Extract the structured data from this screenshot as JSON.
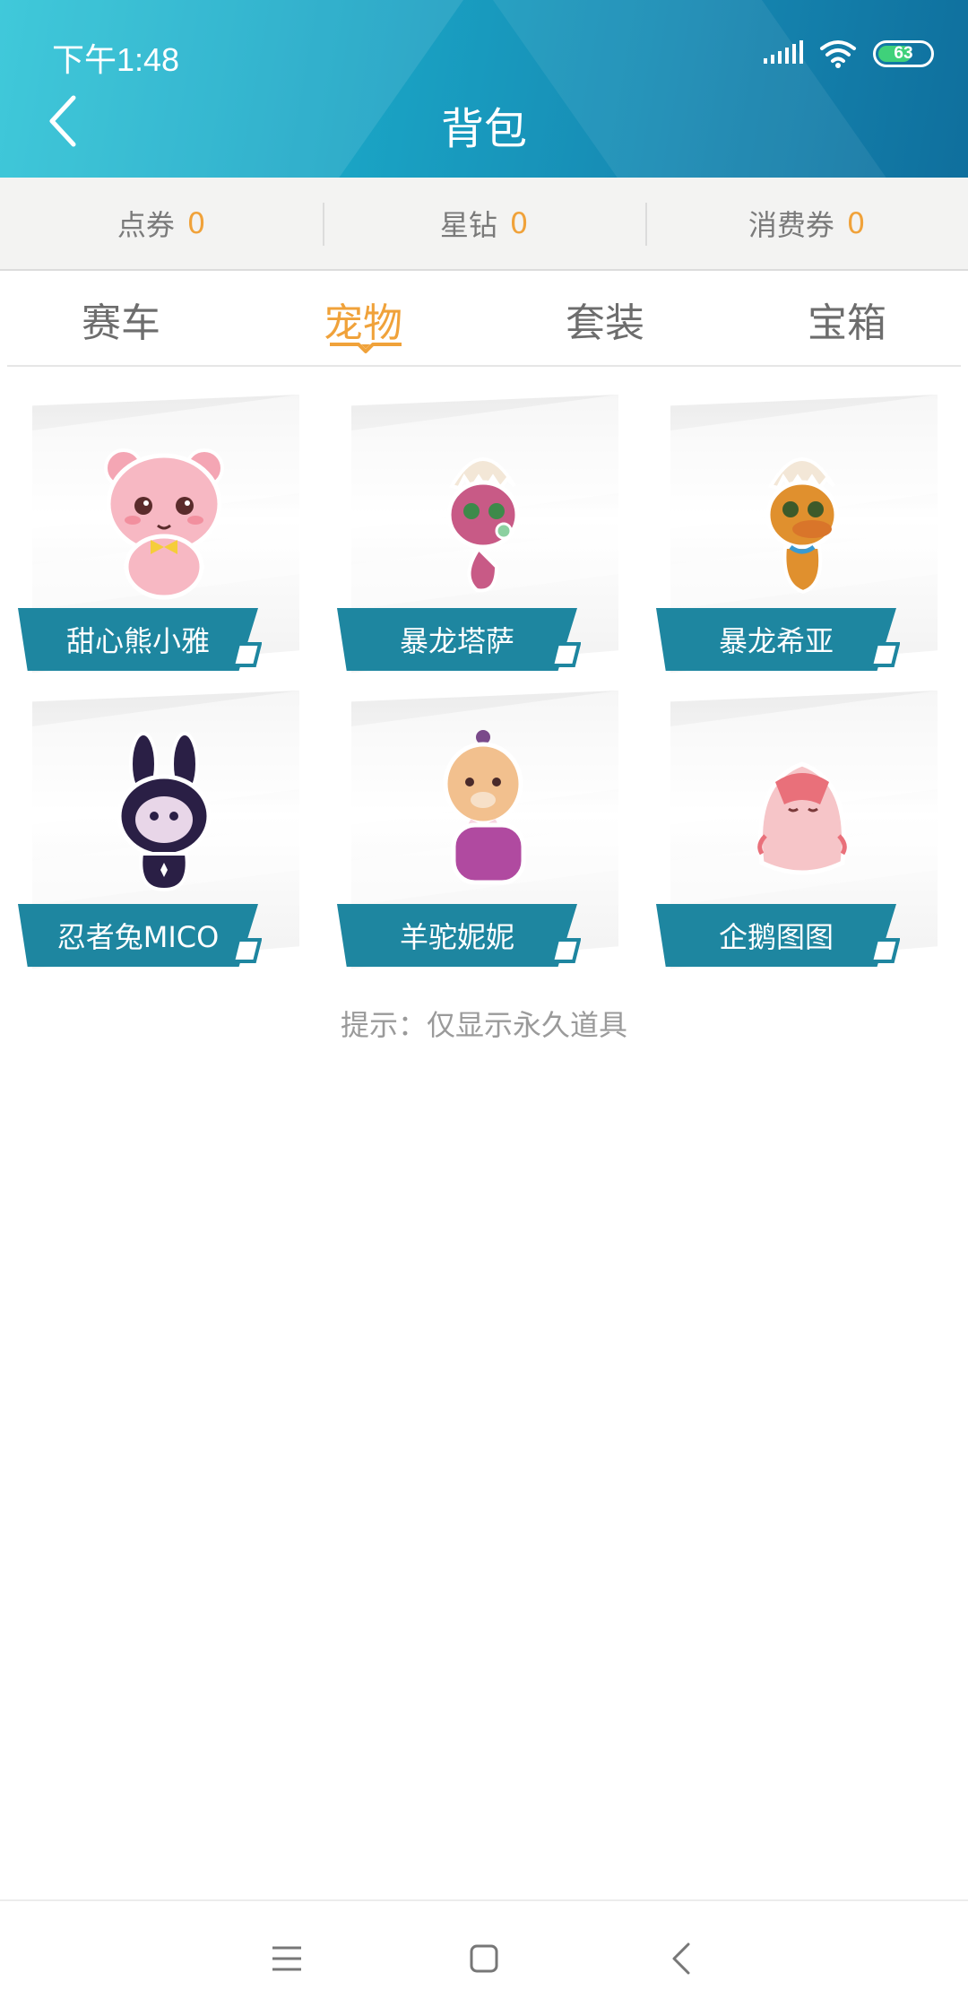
{
  "status": {
    "time": "下午1:48",
    "battery": "63",
    "signal": "signal-icon",
    "wifi": "wifi-icon"
  },
  "header": {
    "title": "背包",
    "back_icon": "back-chevron-icon"
  },
  "currencies": [
    {
      "label": "点券",
      "value": "0"
    },
    {
      "label": "星钻",
      "value": "0"
    },
    {
      "label": "消费券",
      "value": "0"
    }
  ],
  "tabs": [
    {
      "label": "赛车",
      "active": false
    },
    {
      "label": "宠物",
      "active": true
    },
    {
      "label": "套装",
      "active": false
    },
    {
      "label": "宝箱",
      "active": false
    }
  ],
  "pets": [
    {
      "name": "甜心熊小雅",
      "icon": "pink-bear-icon"
    },
    {
      "name": "暴龙塔萨",
      "icon": "purple-dino-hatchling-icon"
    },
    {
      "name": "暴龙希亚",
      "icon": "orange-dino-hatchling-icon"
    },
    {
      "name": "忍者兔MICO",
      "icon": "ninja-rabbit-icon"
    },
    {
      "name": "羊驼妮妮",
      "icon": "alpaca-icon"
    },
    {
      "name": "企鹅图图",
      "icon": "pink-penguin-icon"
    }
  ],
  "hint": "提示：仅显示永久道具",
  "colors": {
    "accent": "#f0a23a",
    "label_bg": "#1e86a0",
    "header_start": "#2bc3d6",
    "header_end": "#0f6f9d"
  }
}
